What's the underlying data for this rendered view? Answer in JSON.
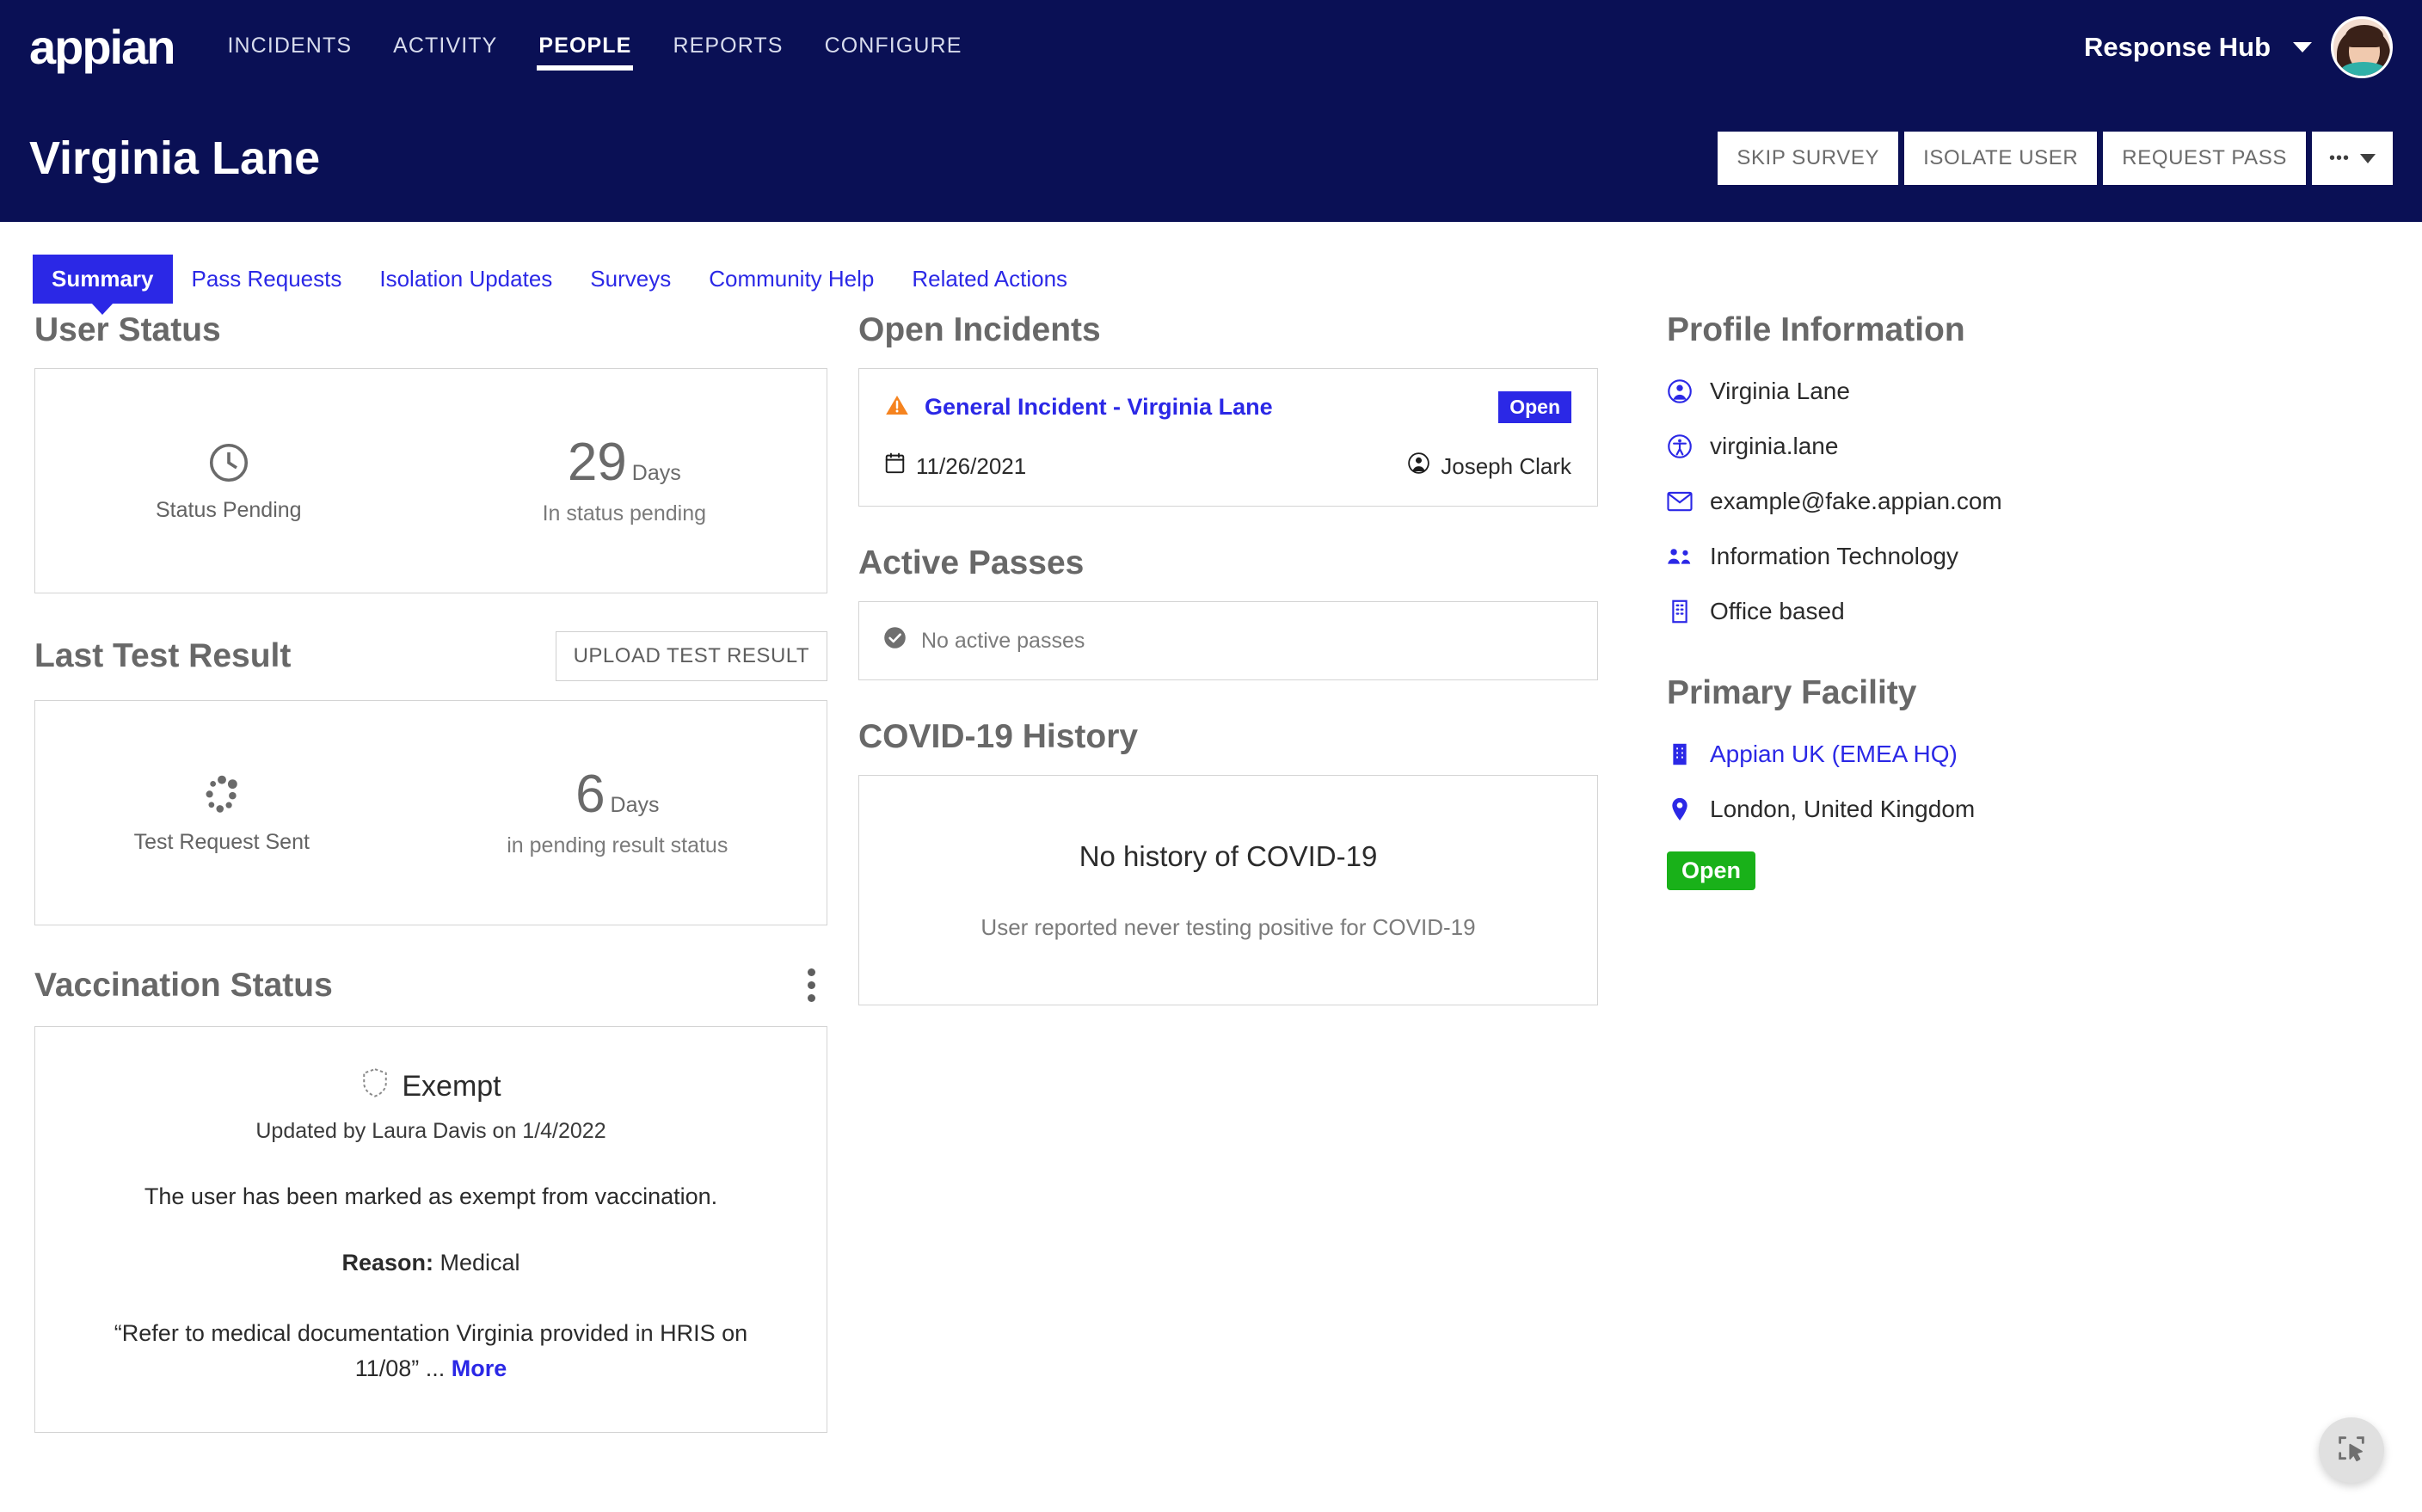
{
  "brand": {
    "logo_text": "appian",
    "navy": "#0A1055",
    "accent_blue": "#2B28E6",
    "green": "#19B119",
    "orange": "#F5831F"
  },
  "topnav": {
    "items": [
      {
        "label": "INCIDENTS",
        "active": false
      },
      {
        "label": "ACTIVITY",
        "active": false
      },
      {
        "label": "PEOPLE",
        "active": true
      },
      {
        "label": "REPORTS",
        "active": false
      },
      {
        "label": "CONFIGURE",
        "active": false
      }
    ],
    "hub_label": "Response Hub",
    "hub_caret_icon": "chevron-down-icon",
    "avatar_icon": "user-avatar"
  },
  "titlebar": {
    "title": "Virginia Lane",
    "actions": [
      {
        "label": "SKIP SURVEY"
      },
      {
        "label": "ISOLATE USER"
      },
      {
        "label": "REQUEST PASS"
      }
    ],
    "more_dots": "•••"
  },
  "tabs": [
    {
      "label": "Summary",
      "active": true
    },
    {
      "label": "Pass Requests",
      "active": false
    },
    {
      "label": "Isolation Updates",
      "active": false
    },
    {
      "label": "Surveys",
      "active": false
    },
    {
      "label": "Community Help",
      "active": false
    },
    {
      "label": "Related Actions",
      "active": false
    }
  ],
  "user_status": {
    "heading": "User Status",
    "status_icon": "clock-icon",
    "status_label": "Status Pending",
    "days_value": "29",
    "days_unit": "Days",
    "days_sub": "In status pending"
  },
  "last_test": {
    "heading": "Last Test Result",
    "upload_button": "UPLOAD TEST RESULT",
    "status_icon": "spinner-icon",
    "status_label": "Test Request Sent",
    "days_value": "6",
    "days_unit": "Days",
    "days_sub": "in pending result status"
  },
  "vaccination": {
    "heading": "Vaccination Status",
    "kebab_icon": "kebab-menu-icon",
    "status_icon": "shield-check-dashed-icon",
    "status": "Exempt",
    "updated": "Updated by Laura Davis on 1/4/2022",
    "body": "The user has been marked as exempt from vaccination.",
    "reason_label": "Reason:",
    "reason_value": "Medical",
    "quote": "“Refer to medical documentation Virginia provided in HRIS on 11/08” ...",
    "more_label": "More"
  },
  "open_incidents": {
    "heading": "Open Incidents",
    "items": [
      {
        "warning_icon": "warning-triangle-icon",
        "title": "General Incident - Virginia Lane",
        "status_badge": "Open",
        "date_icon": "calendar-icon",
        "date": "11/26/2021",
        "owner_icon": "person-icon",
        "owner": "Joseph Clark"
      }
    ]
  },
  "active_passes": {
    "heading": "Active Passes",
    "empty_icon": "check-circle-icon",
    "empty_text": "No active passes"
  },
  "covid_history": {
    "heading": "COVID-19 History",
    "title": "No history of COVID-19",
    "subtitle": "User reported never testing positive for COVID-19"
  },
  "profile_information": {
    "heading": "Profile Information",
    "rows": [
      {
        "icon": "person-circle-icon",
        "text": "Virginia Lane",
        "link": false
      },
      {
        "icon": "accessibility-icon",
        "text": "virginia.lane",
        "link": false
      },
      {
        "icon": "envelope-icon",
        "text": "example@fake.appian.com",
        "link": false
      },
      {
        "icon": "people-group-icon",
        "text": "Information Technology",
        "link": false
      },
      {
        "icon": "building-icon",
        "text": "Office based",
        "link": false
      }
    ]
  },
  "primary_facility": {
    "heading": "Primary Facility",
    "facility_icon": "building-icon",
    "facility_name": "Appian UK (EMEA HQ)",
    "location_icon": "map-pin-icon",
    "location": "London, United Kingdom",
    "status_badge": "Open"
  },
  "fab": {
    "icon": "select-cursor-icon"
  }
}
